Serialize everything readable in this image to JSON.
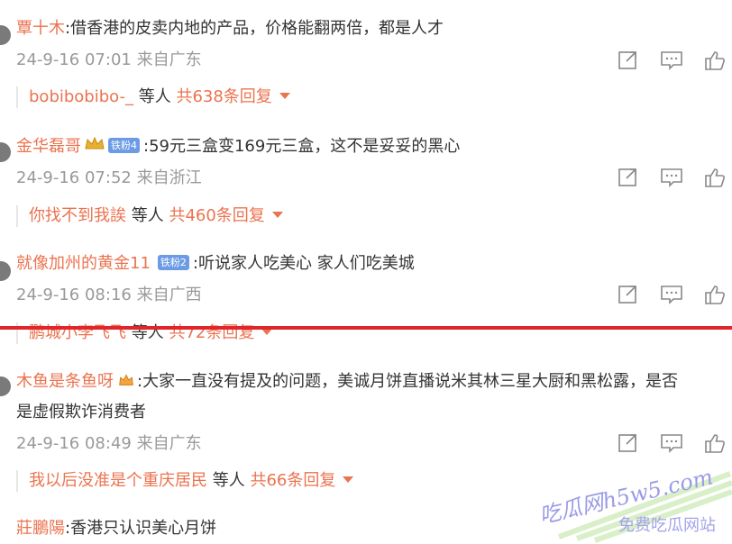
{
  "comments": [
    {
      "user": "覃十木",
      "text": ":借香港的皮卖内地的产品，价格能翻两倍，都是人才",
      "meta": "24-9-16 07:01 来自广东",
      "reply_users": "bobibobibo-_",
      "reply_mid": " 等人 ",
      "reply_count": "共638条回复"
    },
    {
      "user": "金华磊哥",
      "badge": "铁粉4",
      "text": ":59元三盒变169元三盒，这不是妥妥的黑心",
      "meta": "24-9-16 07:52 来自浙江",
      "reply_users": "你找不到我誒",
      "reply_mid": " 等人 ",
      "reply_count": "共460条回复"
    },
    {
      "user": "就像加州的黄金11",
      "badge": "铁粉2",
      "text": ":听说家人吃美心 家人们吃美城",
      "meta": "24-9-16 08:16 来自广西",
      "reply_users": "鹏城小李飞飞",
      "reply_mid": " 等人 ",
      "reply_count": "共72条回复"
    },
    {
      "user": "木鱼是条鱼呀",
      "text": ":大家一直没有提及的问题，美诚月饼直播说米其林三星大厨和黑松露，是否",
      "text2": "是虚假欺诈消费者",
      "meta": "24-9-16 08:49 来自广东",
      "reply_users": "我以后没准是个重庆居民",
      "reply_mid": " 等人 ",
      "reply_count": "共66条回复"
    },
    {
      "user": "莊鵬陽",
      "text": ":香港只认识美心月饼"
    }
  ],
  "watermark": {
    "site": "吃瓜网h5w5.com",
    "slogan": "免费吃瓜网站"
  },
  "colors": {
    "name": "#eb7350",
    "meta": "#999999",
    "divider": "#e0262a"
  }
}
